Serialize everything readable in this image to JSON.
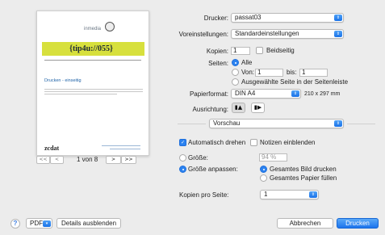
{
  "preview": {
    "logo": "inmedia",
    "title": "{tip4u://055}",
    "heading": "Drucken - einseitig",
    "footer_logo": "zcdat",
    "pager_first": "<<",
    "pager_prev": "<",
    "page_indicator": "1 von 8",
    "pager_next": ">",
    "pager_last": ">>"
  },
  "form": {
    "printer_label": "Drucker:",
    "printer_value": "passat03",
    "presets_label": "Voreinstellungen:",
    "presets_value": "Standardeinstellungen",
    "copies_label": "Kopien:",
    "copies_value": "1",
    "duplex_label": "Beidseitig",
    "duplex_checked": false,
    "pages_label": "Seiten:",
    "pages_all": "Alle",
    "pages_from": "Von:",
    "pages_from_value": "1",
    "pages_to": "bis:",
    "pages_to_value": "1",
    "pages_selection": "Ausgewählte Seite in der Seitenleiste",
    "paper_label": "Papierformat:",
    "paper_value": "DIN A4",
    "paper_size": "210 x 297 mm",
    "orientation_label": "Ausrichtung:",
    "section_value": "Vorschau",
    "auto_rotate": "Automatisch drehen",
    "auto_rotate_checked": true,
    "show_notes": "Notizen einblenden",
    "show_notes_checked": false,
    "size_label": "Größe:",
    "size_value": "94 %",
    "fit_label": "Größe anpassen:",
    "fit_whole": "Gesamtes Bild drucken",
    "fit_paper": "Gesamtes Papier füllen",
    "pages_per_sheet_label": "Kopien pro Seite:",
    "pages_per_sheet_value": "1"
  },
  "footer": {
    "help": "?",
    "pdf": "PDF",
    "hide_details": "Details ausblenden",
    "cancel": "Abbrechen",
    "print": "Drucken"
  },
  "colors": {
    "accent": "#2b82f0",
    "brand_green": "#d7e03d"
  }
}
